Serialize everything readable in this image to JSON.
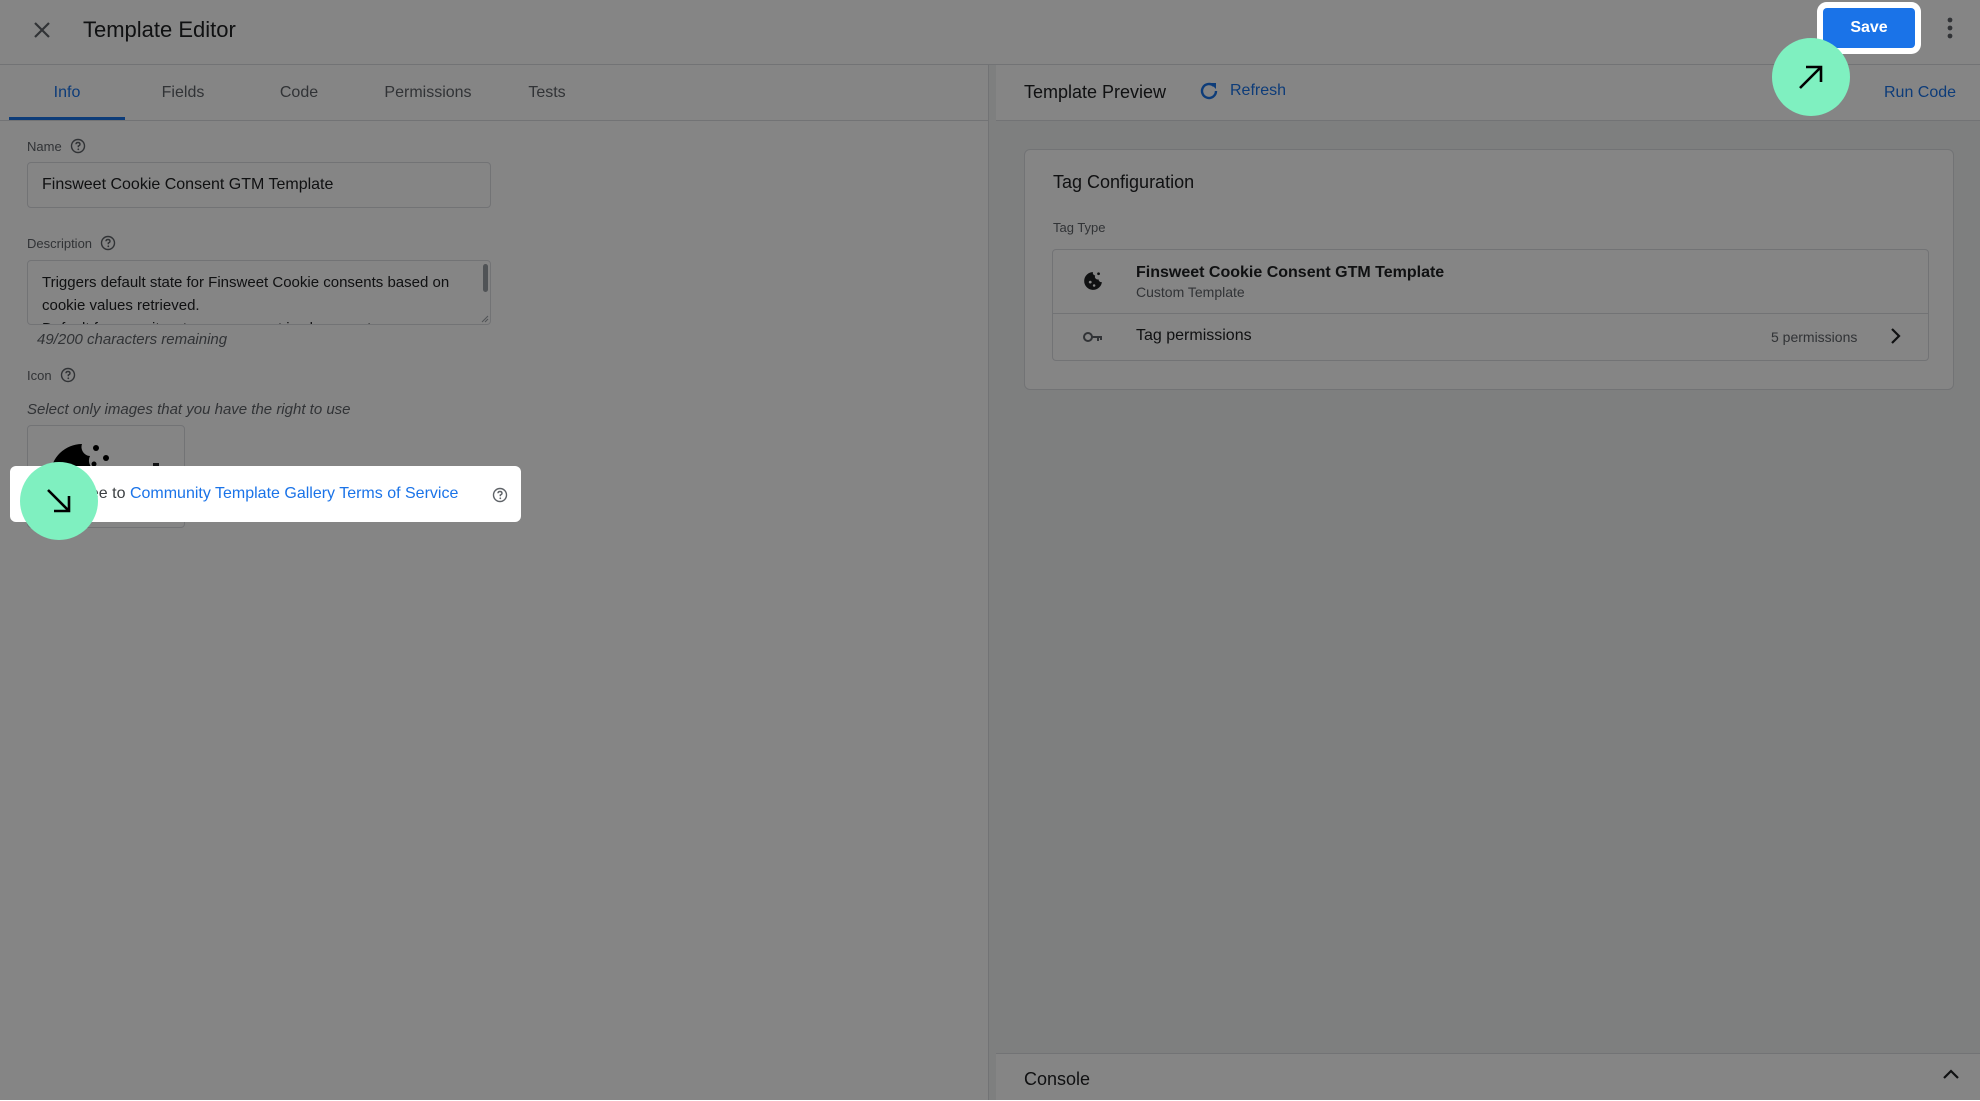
{
  "app": {
    "title": "Template Editor",
    "save_label": "Save"
  },
  "tabs": [
    {
      "label": "Info",
      "active": true
    },
    {
      "label": "Fields"
    },
    {
      "label": "Code"
    },
    {
      "label": "Permissions"
    },
    {
      "label": "Tests"
    }
  ],
  "info": {
    "name_label": "Name",
    "name_value": "Finsweet Cookie Consent GTM Template",
    "description_label": "Description",
    "description_value": "Triggers default state for Finsweet Cookie consents based on cookie values retrieved.\nDefault for security_storage consent is always set as",
    "chars_remaining": "49/200 characters remaining",
    "icon_label": "Icon",
    "icon_note": "Select only images that you have the right to use",
    "tos_prefix": "Agree to ",
    "tos_link": "Community Template Gallery Terms of Service",
    "tos_checked": true
  },
  "preview": {
    "title": "Template Preview",
    "refresh_label": "Refresh",
    "run_code_label": "Run Code",
    "card_title": "Tag Configuration",
    "tag_type_label": "Tag Type",
    "template_name": "Finsweet Cookie Consent GTM Template",
    "template_sub": "Custom Template",
    "permissions_label": "Tag permissions",
    "permissions_count": "5 permissions",
    "console_label": "Console"
  },
  "colors": {
    "accent": "#1a73e8",
    "marker": "#7ff0c0",
    "overlay": "rgba(0,0,0,0.48)"
  },
  "icons": [
    "close-icon",
    "more-vert-icon",
    "help-icon",
    "cookie-icon",
    "trash-icon",
    "check-icon",
    "refresh-icon",
    "key-icon",
    "chevron-right-icon",
    "chevron-up-icon",
    "arrow-up-right-icon",
    "arrow-down-right-icon"
  ]
}
